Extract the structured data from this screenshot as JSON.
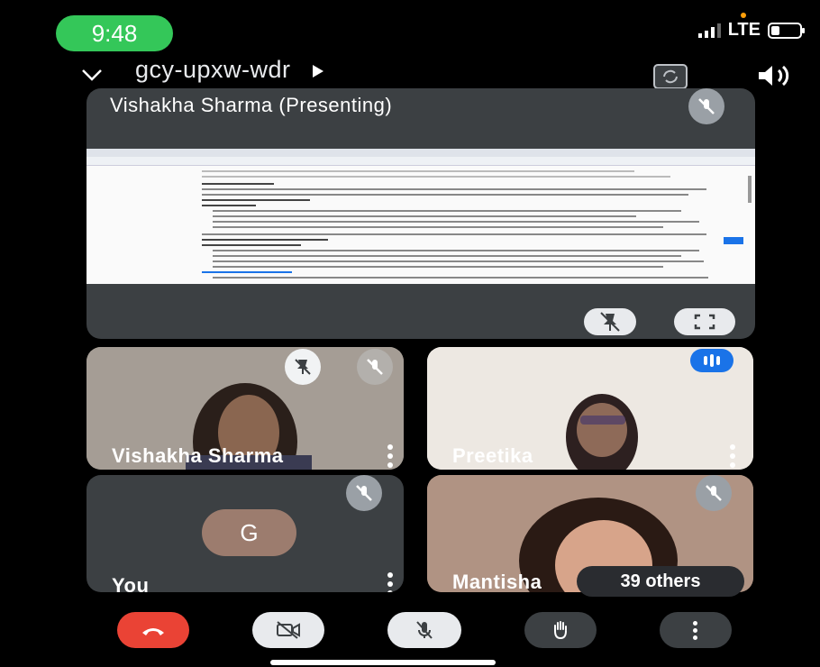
{
  "status_bar": {
    "time": "9:48",
    "network": "LTE"
  },
  "meeting": {
    "code": "gcy-upxw-wdr"
  },
  "presenter_tile": {
    "title": "Vishakha Sharma (Presenting)"
  },
  "participants": [
    {
      "name": "Vishakha Sharma"
    },
    {
      "name": "Preetika"
    },
    {
      "name": "You",
      "avatar_letter": "G"
    },
    {
      "name": "Mantisha",
      "others_label": "39 others"
    }
  ],
  "colors": {
    "end_call": "#ea4335",
    "speaking_indicator": "#1a73e8",
    "time_pill": "#34c759",
    "tile_bg": "#3c4043"
  },
  "icons": [
    "chevron-down-icon",
    "play-icon",
    "camera-switch-icon",
    "speaker-icon",
    "mic-off-icon",
    "pin-icon",
    "fullscreen-icon",
    "speaking-icon",
    "more-vert-icon",
    "end-call-icon",
    "video-off-icon",
    "raise-hand-icon"
  ]
}
